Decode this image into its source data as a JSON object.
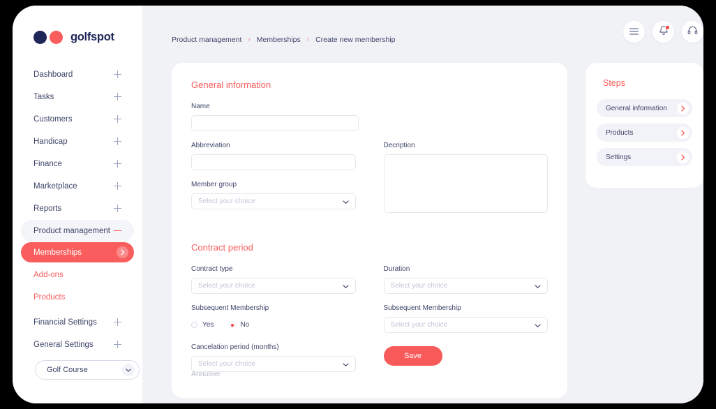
{
  "brand": {
    "name": "golfspot",
    "navy": "#1F2759",
    "coral": "#FA5D5D"
  },
  "sidebar": {
    "items": [
      {
        "label": "Dashboard",
        "icon": "plus-icon",
        "expanded": false
      },
      {
        "label": "Tasks",
        "icon": "plus-icon",
        "expanded": false
      },
      {
        "label": "Customers",
        "icon": "plus-icon",
        "expanded": false
      },
      {
        "label": "Handicap",
        "icon": "plus-icon",
        "expanded": false
      },
      {
        "label": "Finance",
        "icon": "plus-icon",
        "expanded": false
      },
      {
        "label": "Marketplace",
        "icon": "plus-icon",
        "expanded": false
      },
      {
        "label": "Reports",
        "icon": "plus-icon",
        "expanded": false
      },
      {
        "label": "Product management",
        "icon": "minus-icon",
        "expanded": true
      }
    ],
    "sub_items": [
      {
        "label": "Memberships",
        "active": true
      },
      {
        "label": "Add-ons",
        "active": false
      },
      {
        "label": "Products",
        "active": false
      }
    ],
    "items_after": [
      {
        "label": "Financial Settings",
        "icon": "plus-icon",
        "expanded": false
      },
      {
        "label": "General Settings",
        "icon": "plus-icon",
        "expanded": false
      }
    ],
    "course_select": {
      "value": "Golf Course",
      "icon": "chevron-down-icon"
    }
  },
  "topbar": {
    "breadcrumb": [
      "Product management",
      "Memberships",
      "Create new membership"
    ],
    "separator": "›",
    "icons": [
      {
        "name": "menu-icon"
      },
      {
        "name": "bell-icon",
        "badge": true
      },
      {
        "name": "headset-icon"
      }
    ]
  },
  "form": {
    "general_section_title": "General information",
    "contract_section_title": "Contract period",
    "placeholder": "Select your choice",
    "fields": {
      "name": {
        "label": "Name",
        "value": ""
      },
      "abbreviation": {
        "label": "Abbreviation",
        "value": ""
      },
      "description": {
        "label": "Decription",
        "value": ""
      },
      "member_group": {
        "label": "Member group",
        "value": "Select your choice"
      },
      "contract_type": {
        "label": "Contract type",
        "value": "Select your choice"
      },
      "duration": {
        "label": "Duration",
        "value": "Select your choice"
      },
      "subsequent_membership_radio": {
        "label": "Subsequent Membership"
      },
      "subsequent_membership_select": {
        "label": "Subsequent Membership",
        "value": "Select your choice"
      },
      "cancelation_period": {
        "label": "Cancelation period (months)",
        "value": "Select your choice"
      }
    },
    "radio_options": [
      {
        "label": "Yes",
        "selected": false
      },
      {
        "label": "No",
        "selected": true
      }
    ],
    "cancel_label": "Annuleer",
    "save_label": "Save"
  },
  "steps": {
    "title": "Steps",
    "items": [
      {
        "label": "General information"
      },
      {
        "label": "Products"
      },
      {
        "label": "Settings"
      }
    ]
  }
}
